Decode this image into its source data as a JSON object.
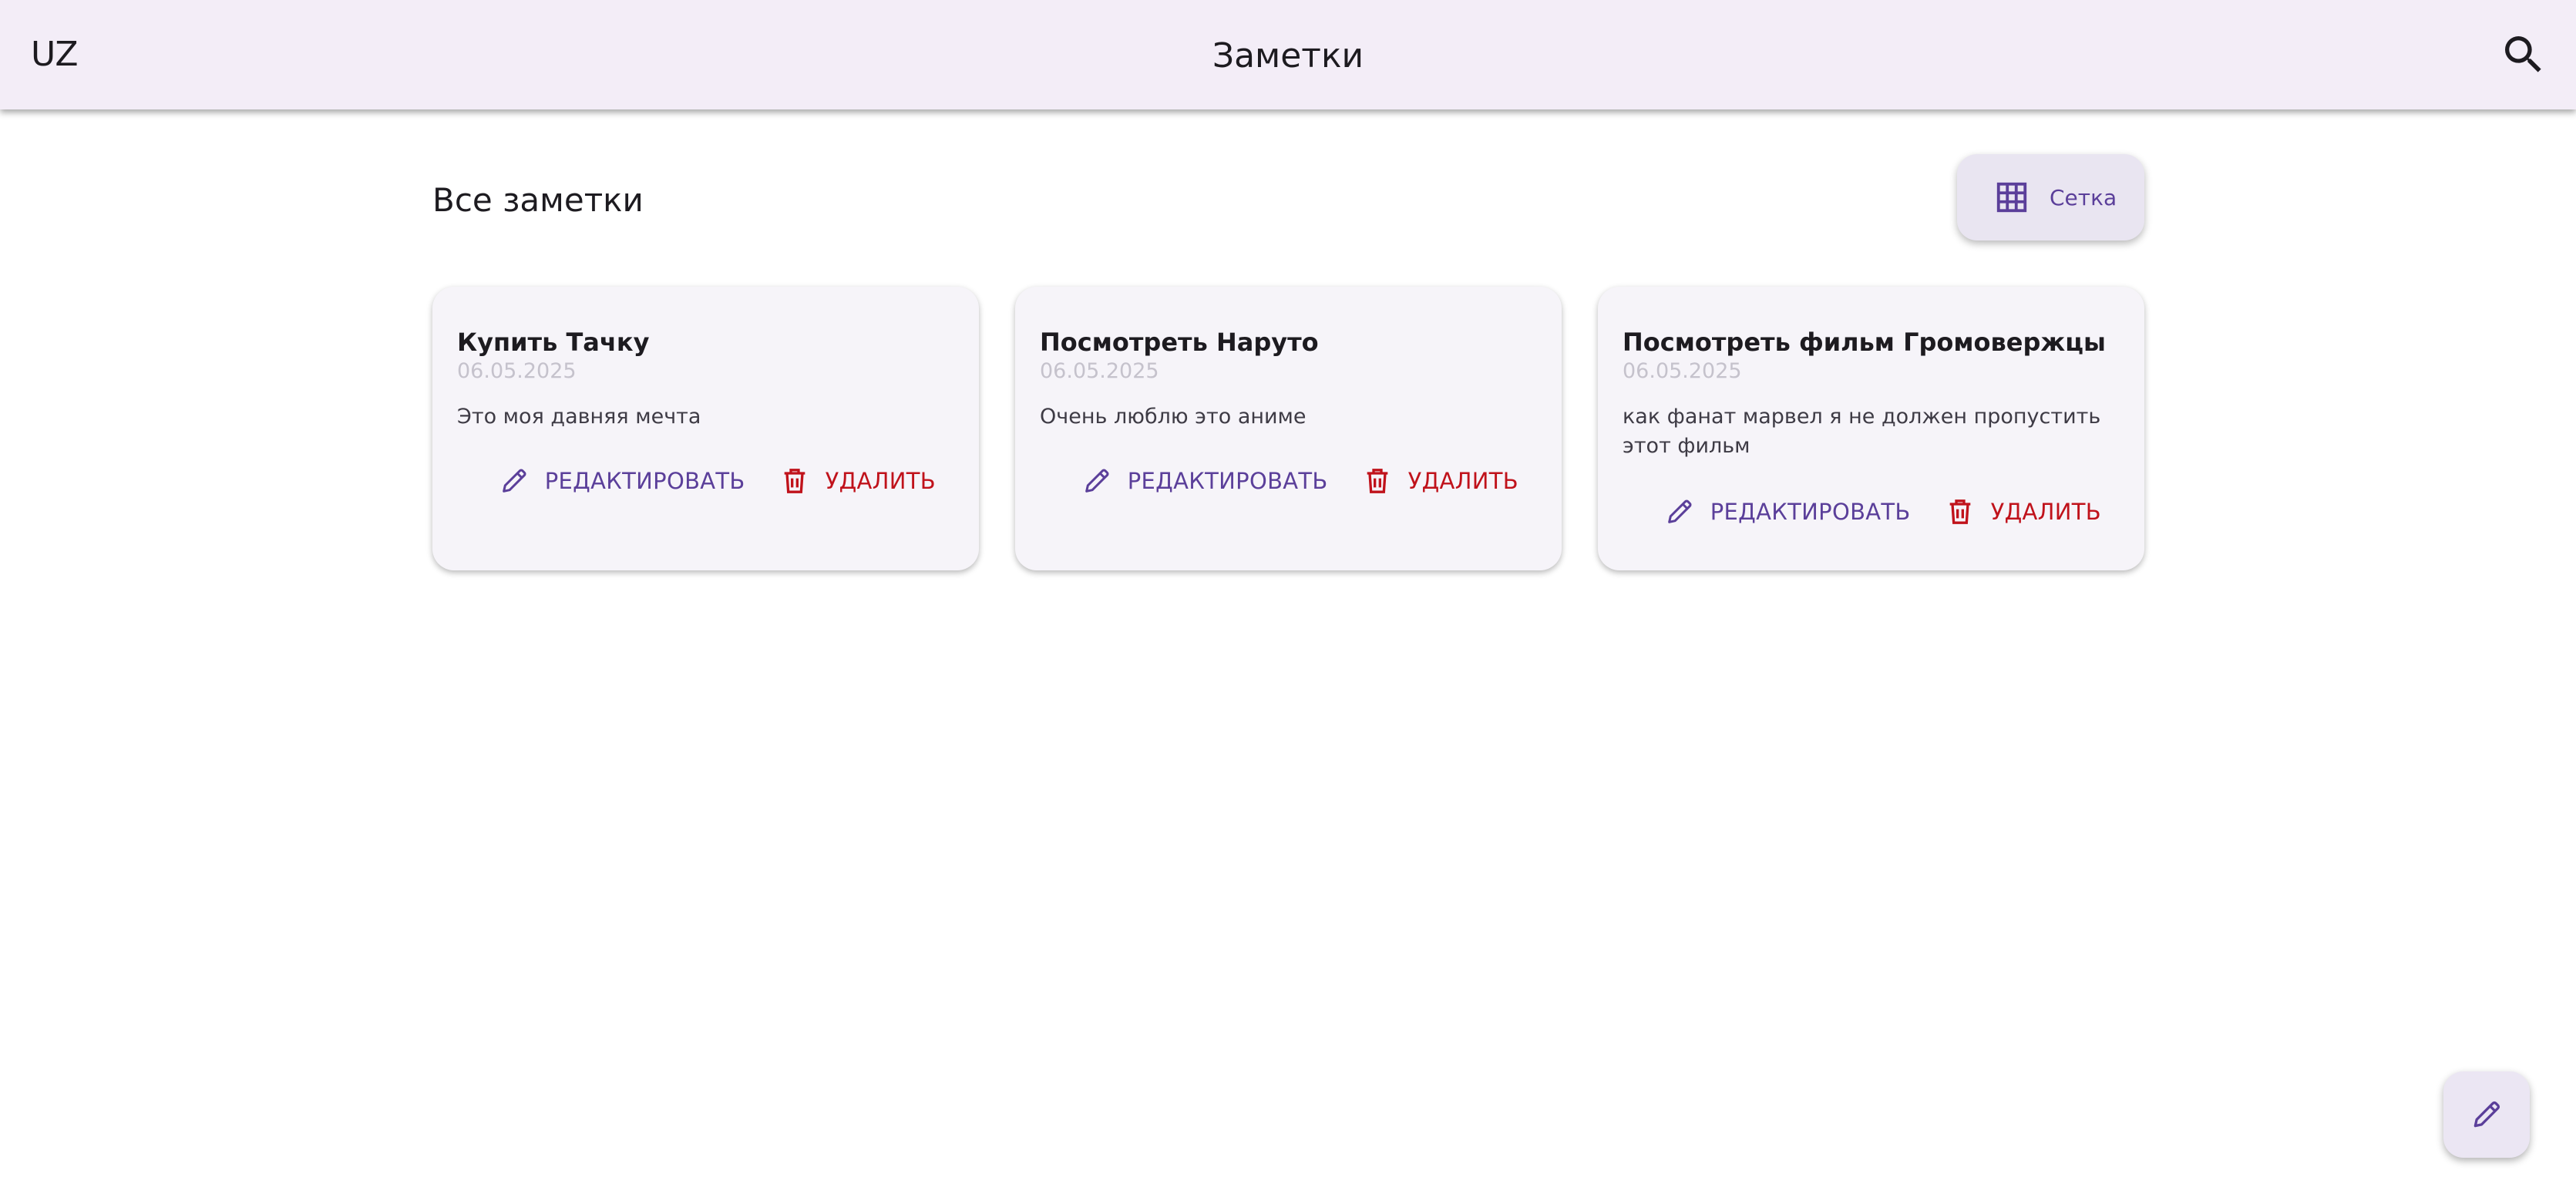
{
  "appbar": {
    "logo": "UZ",
    "title": "Заметки",
    "search_icon": "search-icon"
  },
  "section": {
    "title": "Все заметки",
    "view_toggle_label": "Сетка",
    "view_toggle_icon": "grid-icon"
  },
  "notes": [
    {
      "title": "Купить Тачку",
      "date": "06.05.2025",
      "body": "Это моя давняя мечта",
      "edit_label": "РЕДАКТИРОВАТЬ",
      "delete_label": "УДАЛИТЬ"
    },
    {
      "title": "Посмотреть Наруто",
      "date": "06.05.2025",
      "body": "Очень люблю это аниме",
      "edit_label": "РЕДАКТИРОВАТЬ",
      "delete_label": "УДАЛИТЬ"
    },
    {
      "title": "Посмотреть фильм Громовержцы",
      "date": "06.05.2025",
      "body": "как фанат марвел я не должен пропустить этот фильм",
      "edit_label": "РЕДАКТИРОВАТЬ",
      "delete_label": "УДАЛИТЬ"
    }
  ],
  "fab": {
    "icon": "pencil-icon"
  },
  "colors": {
    "appbar_bg": "#f3edf7",
    "primary": "#5b3f9a",
    "danger": "#c0121b",
    "card_bg": "#f6f4f9",
    "date": "#c5c2cc"
  }
}
